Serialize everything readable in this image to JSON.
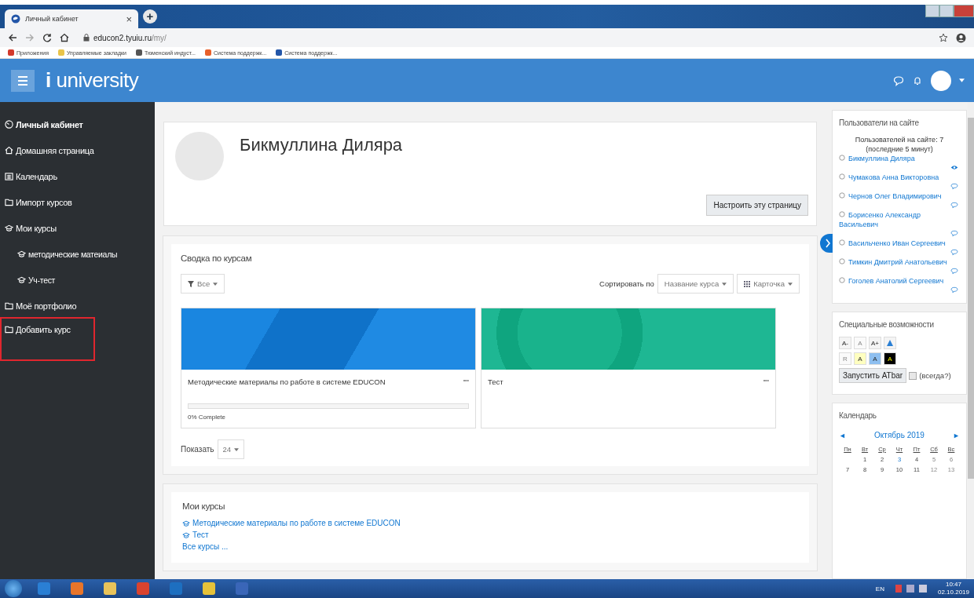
{
  "browser": {
    "tab": {
      "title": "Личный кабинет",
      "close": "×"
    },
    "new_tab": "+",
    "address": {
      "host": "educon2.tyuiu.ru",
      "path": "/my/"
    },
    "bookmarks": [
      {
        "label": "Приложения",
        "color": "#d33a2c"
      },
      {
        "label": "Управляемые закладки",
        "color": "#e9c44a"
      },
      {
        "label": "Тюменский индуст...",
        "color": "#555555"
      },
      {
        "label": "Система поддержк...",
        "color": "#e8602a"
      },
      {
        "label": "Система поддержк...",
        "color": "#2356a8"
      }
    ]
  },
  "navbar": {
    "logo_mark": "i",
    "logo_text": "university"
  },
  "sidebar": {
    "items": [
      {
        "label": "Личный кабинет",
        "indented": false,
        "selected": true,
        "highlighted": false
      },
      {
        "label": "Домашняя страница",
        "indented": false,
        "selected": false,
        "highlighted": false
      },
      {
        "label": "Календарь",
        "indented": false,
        "selected": false,
        "highlighted": false
      },
      {
        "label": "Импорт курсов",
        "indented": false,
        "selected": false,
        "highlighted": false
      },
      {
        "label": "Мои курсы",
        "indented": false,
        "selected": false,
        "highlighted": false
      },
      {
        "label": "методические матеиалы",
        "indented": true,
        "selected": false,
        "highlighted": false
      },
      {
        "label": "Уч-тест",
        "indented": true,
        "selected": false,
        "highlighted": false
      },
      {
        "label": "Моё портфолио",
        "indented": false,
        "selected": false,
        "highlighted": false
      },
      {
        "label": "Добавить курс",
        "indented": false,
        "selected": false,
        "highlighted": true
      }
    ]
  },
  "profile": {
    "name": "Бикмуллина Диляра",
    "customize_button": "Настроить эту страницу"
  },
  "overview": {
    "title": "Сводка по курсам",
    "filter": "Все",
    "sort_label": "Сортировать по",
    "sort": "Название курса",
    "view": "Карточка",
    "courses": [
      {
        "title": "Методические материалы по работе в системе EDUCON",
        "menu": "•••",
        "progress": {
          "level": 0,
          "label": "0% Complete"
        }
      },
      {
        "title": "Тест",
        "menu": "•••"
      }
    ],
    "show_label": "Показать",
    "show_count": "24"
  },
  "my_courses": {
    "title": "Мои курсы",
    "courses": [
      "Методические материалы по работе в системе EDUCON",
      "Тест"
    ],
    "all_link": "Все курсы ..."
  },
  "online_users": {
    "title": "Пользователи на сайте",
    "summary": "Пользователей на сайте: 7",
    "period": "(последние 5 минут)",
    "users": [
      {
        "name": "Бикмуллина Диляра",
        "kind": "self"
      },
      {
        "name": "Чумакова Анна Викторовна",
        "kind": "other"
      },
      {
        "name": "Чернов Олег Владимирович",
        "kind": "other"
      },
      {
        "name": "Борисенко Александр Васильевич",
        "kind": "other"
      },
      {
        "name": "Васильченко Иван Сергеевич",
        "kind": "other"
      },
      {
        "name": "Тимкин Дмитрий Анатольевич",
        "kind": "other"
      },
      {
        "name": "Гоголев Анатолий Сергеевич",
        "kind": "other"
      }
    ]
  },
  "accessibility": {
    "title": "Специальные возможности",
    "buttons": [
      [
        {
          "label": "A-",
          "kind": "normal"
        },
        {
          "label": "A",
          "kind": "disabled"
        },
        {
          "label": "A+",
          "kind": "normal"
        },
        {
          "kind": "image"
        }
      ],
      [
        {
          "label": "R",
          "kind": "disabled"
        },
        {
          "label": "A",
          "kind": "yellow"
        },
        {
          "label": "A",
          "kind": "blue"
        },
        {
          "label": "A",
          "kind": "black"
        }
      ]
    ],
    "launch_button": "Запустить ATbar",
    "always_label": "(всегда?)",
    "always_checked": false
  },
  "calendar": {
    "title": "Календарь",
    "prev": "◄",
    "month": "Октябрь 2019",
    "next": "►",
    "weekdays": [
      "Пн",
      "Вт",
      "Ср",
      "Чт",
      "Пт",
      "Сб",
      "Вс"
    ],
    "weeks": [
      [
        {
          "day": "1",
          "today": false
        },
        {
          "day": "2",
          "today": false
        },
        {
          "day": "3",
          "today": true
        },
        {
          "day": "4",
          "today": false
        },
        {
          "day": "5",
          "today": false
        },
        {
          "day": "6",
          "today": false
        }
      ],
      [
        {
          "day": "7",
          "today": false
        },
        {
          "day": "8",
          "today": false
        },
        {
          "day": "9",
          "today": false
        },
        {
          "day": "10",
          "today": false
        },
        {
          "day": "11",
          "today": false
        },
        {
          "day": "12",
          "today": false
        },
        {
          "day": "13",
          "today": false
        }
      ]
    ]
  },
  "taskbar": {
    "apps": [
      {
        "color": "#2a7fd4"
      },
      {
        "color": "#e8752a"
      },
      {
        "color": "#e8c35a"
      },
      {
        "color": "#d9432f"
      },
      {
        "color": "#1d6fc0"
      },
      {
        "color": "#e6c23a"
      },
      {
        "color": "#3a66b8"
      }
    ],
    "language": "EN",
    "time": "10:47",
    "date": "02.10.2019"
  }
}
